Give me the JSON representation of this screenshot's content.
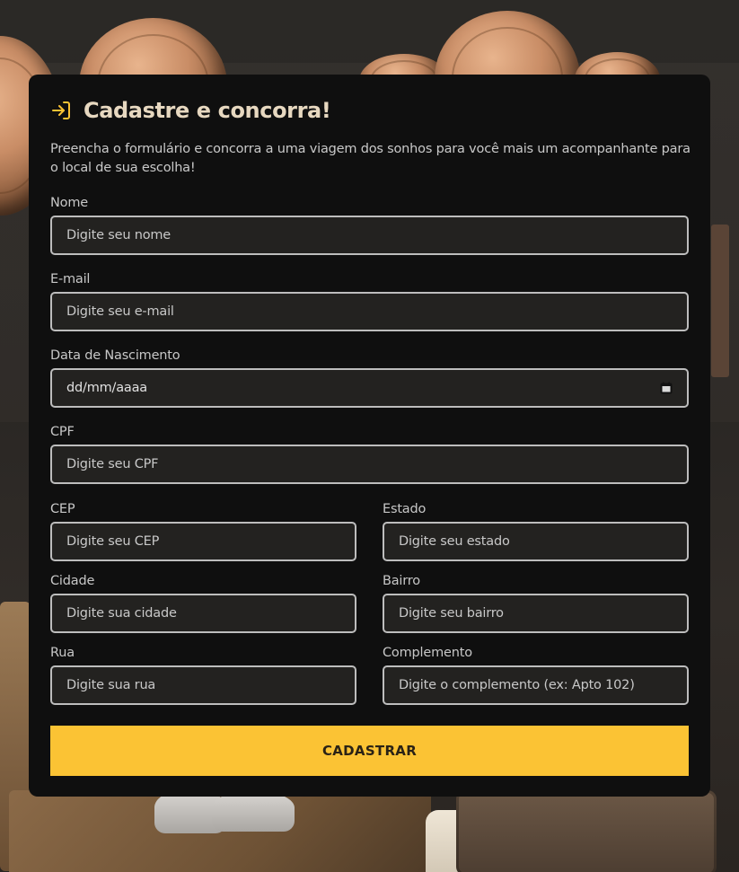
{
  "form": {
    "title": "Cadastre e concorra!",
    "subtitle": "Preencha o formulário e concorra a uma viagem dos sonhos para você mais um acompanhante para o local de sua escolha!",
    "fields": {
      "nome": {
        "label": "Nome",
        "placeholder": "Digite seu nome"
      },
      "email": {
        "label": "E-mail",
        "placeholder": "Digite seu e-mail"
      },
      "nascimento": {
        "label": "Data de Nascimento",
        "placeholder": "dd/mm/aaaa"
      },
      "cpf": {
        "label": "CPF",
        "placeholder": "Digite seu CPF"
      },
      "cep": {
        "label": "CEP",
        "placeholder": "Digite seu CEP"
      },
      "estado": {
        "label": "Estado",
        "placeholder": "Digite seu estado"
      },
      "cidade": {
        "label": "Cidade",
        "placeholder": "Digite sua cidade"
      },
      "bairro": {
        "label": "Bairro",
        "placeholder": "Digite seu bairro"
      },
      "rua": {
        "label": "Rua",
        "placeholder": "Digite sua rua"
      },
      "complemento": {
        "label": "Complemento",
        "placeholder": "Digite o complemento (ex: Apto 102)"
      }
    },
    "submit_label": "CADASTRAR"
  },
  "icons": {
    "header": "login-icon",
    "date": "calendar-icon"
  },
  "colors": {
    "accent": "#fbc334",
    "card_bg": "#0f0f0f",
    "title": "#e7d8c0",
    "input_bg": "#232220",
    "input_border": "#bdbdbd"
  }
}
